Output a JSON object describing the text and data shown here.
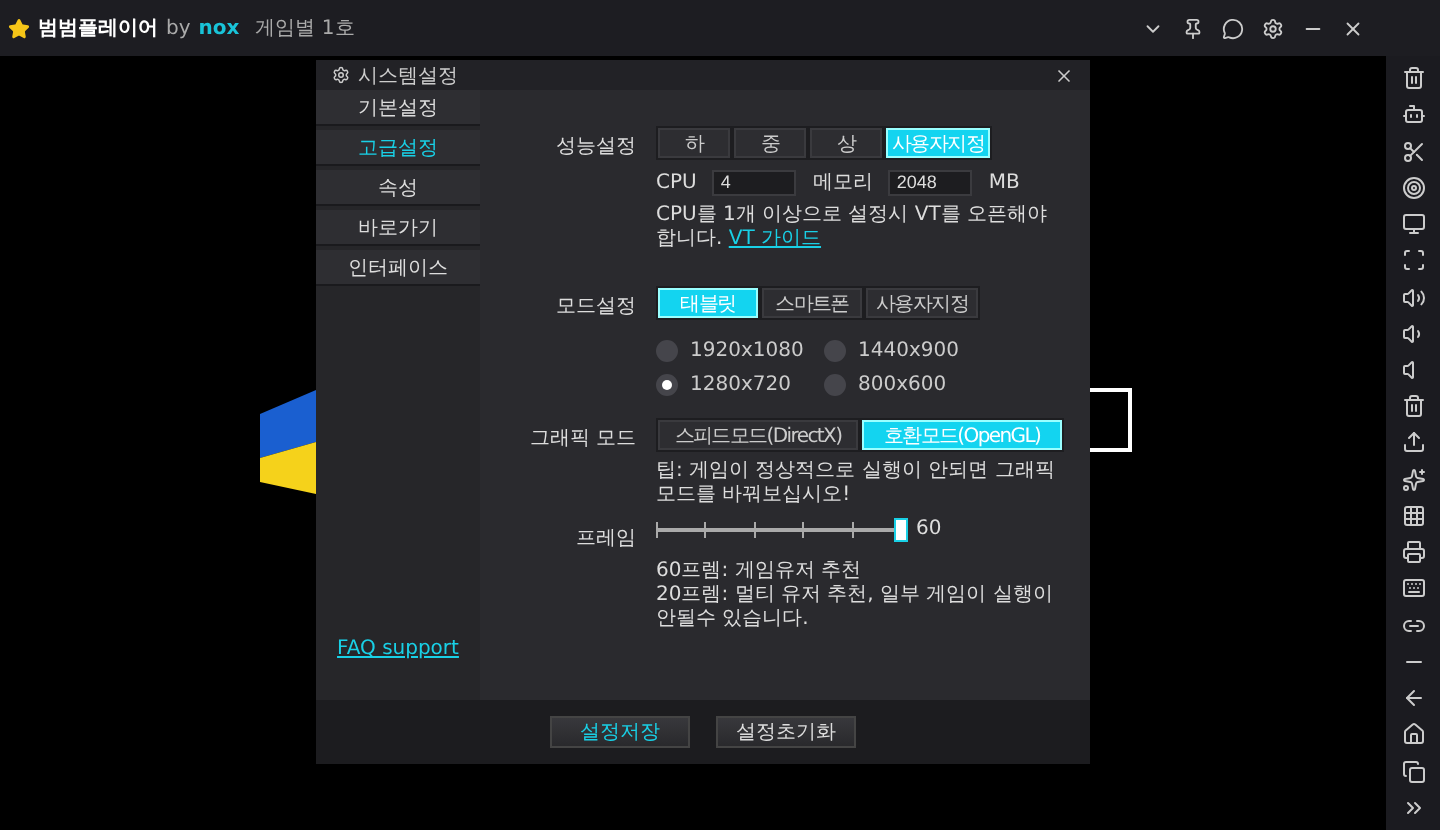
{
  "app_title": {
    "name": "범범플레이어",
    "by": "by",
    "brand": "nox",
    "instance": "게임별 1호"
  },
  "dialog": {
    "title": "시스템설정",
    "tabs": [
      {
        "label": "기본설정",
        "selected": false
      },
      {
        "label": "고급설정",
        "selected": true
      },
      {
        "label": "속성",
        "selected": false
      },
      {
        "label": "바로가기",
        "selected": false
      },
      {
        "label": "인터페이스",
        "selected": false
      }
    ],
    "faq_link": "FAQ support",
    "performance": {
      "label": "성능설정",
      "options": [
        {
          "label": "하",
          "selected": false
        },
        {
          "label": "중",
          "selected": false
        },
        {
          "label": "상",
          "selected": false
        },
        {
          "label": "사용자지정",
          "selected": true
        }
      ],
      "cpu_label": "CPU",
      "cpu_value": "4",
      "memory_label": "메모리",
      "memory_value": "2048",
      "memory_unit": "MB",
      "note": "CPU를 1개 이상으로 설정시 VT를 오픈해야 합니다.",
      "note_link": "VT 가이드"
    },
    "mode": {
      "label": "모드설정",
      "options": [
        {
          "label": "태블릿",
          "selected": true
        },
        {
          "label": "스마트폰",
          "selected": false
        },
        {
          "label": "사용자지정",
          "selected": false
        }
      ],
      "resolutions": [
        {
          "label": "1920x1080",
          "selected": false
        },
        {
          "label": "1440x900",
          "selected": false
        },
        {
          "label": "1280x720",
          "selected": true
        },
        {
          "label": "800x600",
          "selected": false
        }
      ]
    },
    "graphics": {
      "label": "그래픽 모드",
      "options": [
        {
          "label": "스피드모드(DirectX)",
          "selected": false
        },
        {
          "label": "호환모드(OpenGL)",
          "selected": true
        }
      ],
      "tip": "팁: 게임이 정상적으로 실행이 안되면 그래픽 모드를 바꿔보십시오!"
    },
    "frame": {
      "label": "프레임",
      "level": 1,
      "reading": "60",
      "notes": [
        "60프렘: 게임유저 추천",
        "20프렘: 멀티 유저 추천, 일부 게임이 실행이 안될수 있습니다."
      ]
    },
    "buttons": [
      {
        "label": "설정저장",
        "kind": "primary"
      },
      {
        "label": "설정초기화",
        "kind": "normal"
      }
    ]
  }
}
